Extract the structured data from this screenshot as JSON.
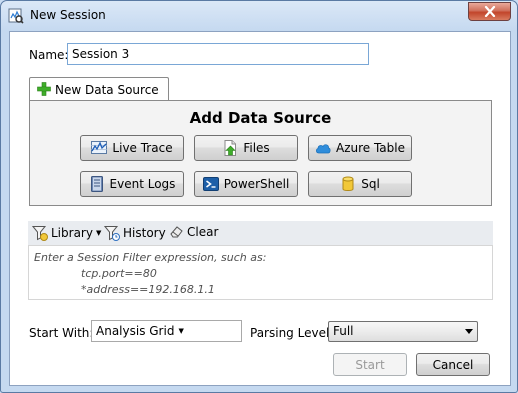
{
  "window": {
    "title": "New Session"
  },
  "name_field": {
    "label": "Name:",
    "value": "Session 3"
  },
  "tab": {
    "label": "New Data Source"
  },
  "data_source": {
    "title": "Add Data Source",
    "buttons": [
      {
        "label": "Live Trace",
        "icon": "live-trace-icon"
      },
      {
        "label": "Files",
        "icon": "files-icon"
      },
      {
        "label": "Azure Table",
        "icon": "azure-cloud-icon"
      },
      {
        "label": "Event Logs",
        "icon": "event-logs-icon"
      },
      {
        "label": "PowerShell",
        "icon": "powershell-icon"
      },
      {
        "label": "Sql",
        "icon": "sql-icon"
      }
    ]
  },
  "filter_toolbar": {
    "library_label": "Library",
    "history_label": "History",
    "clear_label": "Clear"
  },
  "filter_hint": {
    "line1": "Enter a Session Filter expression, such as:",
    "line2": "tcp.port==80",
    "line3": "*address==192.168.1.1"
  },
  "start_with": {
    "label": "Start With:",
    "value": "Analysis Grid"
  },
  "parsing_level": {
    "label": "Parsing Level:",
    "value": "Full"
  },
  "actions": {
    "start_label": "Start",
    "cancel_label": "Cancel"
  }
}
